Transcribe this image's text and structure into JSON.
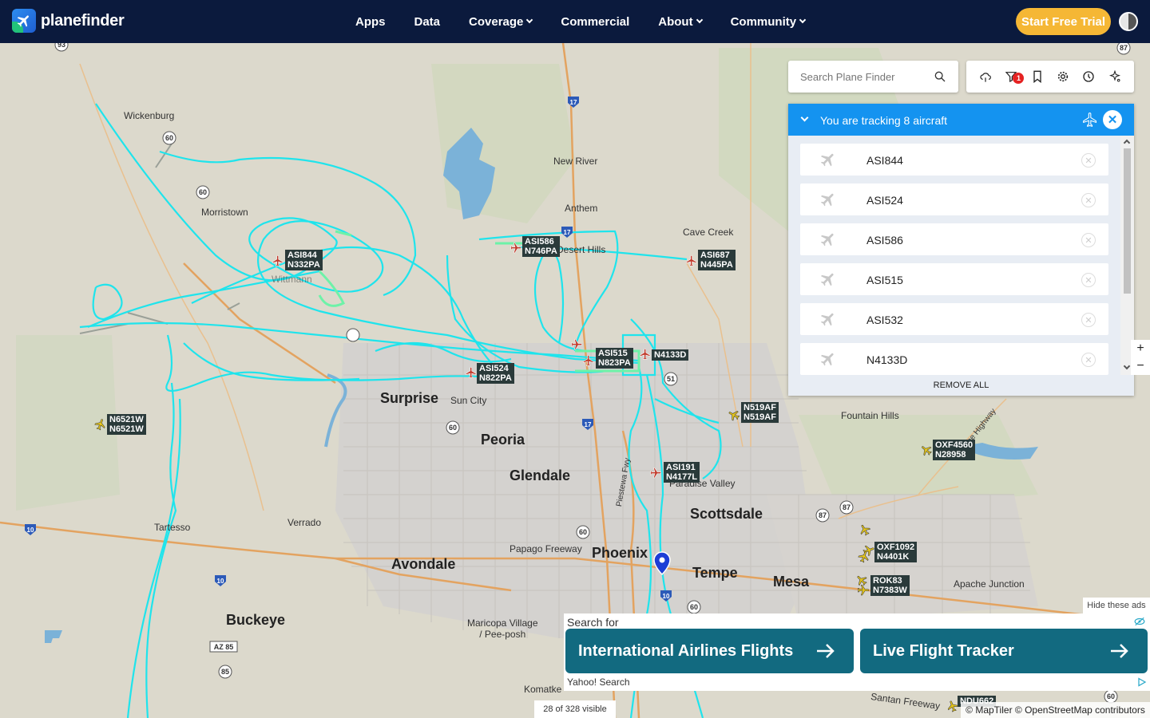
{
  "header": {
    "logo_text": "planefinder",
    "nav": [
      {
        "label": "Apps",
        "dropdown": false
      },
      {
        "label": "Data",
        "dropdown": false
      },
      {
        "label": "Coverage",
        "dropdown": true
      },
      {
        "label": "Commercial",
        "dropdown": false
      },
      {
        "label": "About",
        "dropdown": true
      },
      {
        "label": "Community",
        "dropdown": true
      }
    ],
    "cta_label": "Start Free Trial"
  },
  "search": {
    "placeholder": "Search Plane Finder"
  },
  "toolbar": {
    "filter_badge": "1",
    "tools": [
      "cloud-icon",
      "filter-icon",
      "bookmark-icon",
      "gear-icon",
      "history-icon",
      "sparkle-icon"
    ]
  },
  "tracking": {
    "title": "You are tracking 8 aircraft",
    "items": [
      "ASI844",
      "ASI524",
      "ASI586",
      "ASI515",
      "ASI532",
      "N4133D"
    ],
    "remove_all": "REMOVE ALL"
  },
  "map": {
    "places": [
      {
        "name": "Wickenburg",
        "size": "small"
      },
      {
        "name": "New River",
        "size": "small"
      },
      {
        "name": "Anthem",
        "size": "small"
      },
      {
        "name": "Morristown",
        "size": "small"
      },
      {
        "name": "Cave Creek",
        "size": "small"
      },
      {
        "name": "Desert Hills",
        "size": "small"
      },
      {
        "name": "Wittmann",
        "size": "small"
      },
      {
        "name": "Surprise",
        "size": "big"
      },
      {
        "name": "Sun City",
        "size": "small"
      },
      {
        "name": "Fountain Hills",
        "size": "small"
      },
      {
        "name": "Peoria",
        "size": "big"
      },
      {
        "name": "Glendale",
        "size": "big"
      },
      {
        "name": "Paradise Valley",
        "size": "small"
      },
      {
        "name": "Scottsdale",
        "size": "big"
      },
      {
        "name": "Tartesso",
        "size": "small"
      },
      {
        "name": "Verrado",
        "size": "small"
      },
      {
        "name": "Papago Freeway",
        "size": "small"
      },
      {
        "name": "Phoenix",
        "size": "big"
      },
      {
        "name": "Avondale",
        "size": "big"
      },
      {
        "name": "Tempe",
        "size": "big"
      },
      {
        "name": "Mesa",
        "size": "big"
      },
      {
        "name": "Apache Junction",
        "size": "small"
      },
      {
        "name": "Buckeye",
        "size": "big"
      },
      {
        "name": "Maricopa Village\n/ Pee-posh",
        "size": "small"
      },
      {
        "name": "Komatke",
        "size": "small"
      },
      {
        "name": "Santan Freeway",
        "size": "small"
      },
      {
        "name": "Piestewa Fwy",
        "size": "small"
      },
      {
        "name": "Beeline Highway",
        "size": "small"
      }
    ],
    "aircraft": [
      {
        "line1": "ASI844",
        "line2": "N332PA",
        "color": "#c0392b"
      },
      {
        "line1": "ASI586",
        "line2": "N746PA",
        "color": "#c0392b"
      },
      {
        "line1": "ASI687",
        "line2": "N445PA",
        "color": "#c0392b"
      },
      {
        "line1": "ASI515",
        "line2": "N823PA",
        "color": "#c0392b"
      },
      {
        "line1": "N4133D",
        "line2": "",
        "color": "#c0392b"
      },
      {
        "line1": "ASI524",
        "line2": "N822PA",
        "color": "#c0392b"
      },
      {
        "line1": "N6521W",
        "line2": "N6521W",
        "color": "#e6c619"
      },
      {
        "line1": "N519AF",
        "line2": "N519AF",
        "color": "#e6c619"
      },
      {
        "line1": "OXF4560",
        "line2": "N28958",
        "color": "#e6c619"
      },
      {
        "line1": "ASI191",
        "line2": "N4177L",
        "color": "#c0392b"
      },
      {
        "line1": "OXF1092",
        "line2": "N4401K",
        "color": "#e6c619"
      },
      {
        "line1": "ROK83",
        "line2": "N7383W",
        "color": "#e6c619"
      },
      {
        "line1": "NDU662",
        "line2": "",
        "color": "#e6c619"
      }
    ],
    "shields": [
      "93",
      "17",
      "60",
      "60",
      "17",
      "51",
      "60",
      "17",
      "10",
      "10",
      "60",
      "10",
      "60",
      "87",
      "87",
      "87",
      "85",
      "AZ 85",
      "60"
    ]
  },
  "ads": {
    "hide_label": "Hide these ads",
    "search_for": "Search for",
    "btn1": "International Airlines Flights",
    "btn2": "Live Flight Tracker",
    "provider": "Yahoo! Search"
  },
  "status": {
    "visible_count": "28 of 328 visible",
    "attribution": "© MapTiler © OpenStreetMap contributors"
  },
  "colors": {
    "header_bg": "#0b1a3d",
    "accent": "#1493f0",
    "cta": "#f5b735",
    "track": "#1fe4ec",
    "track_green": "#6df2a8"
  }
}
